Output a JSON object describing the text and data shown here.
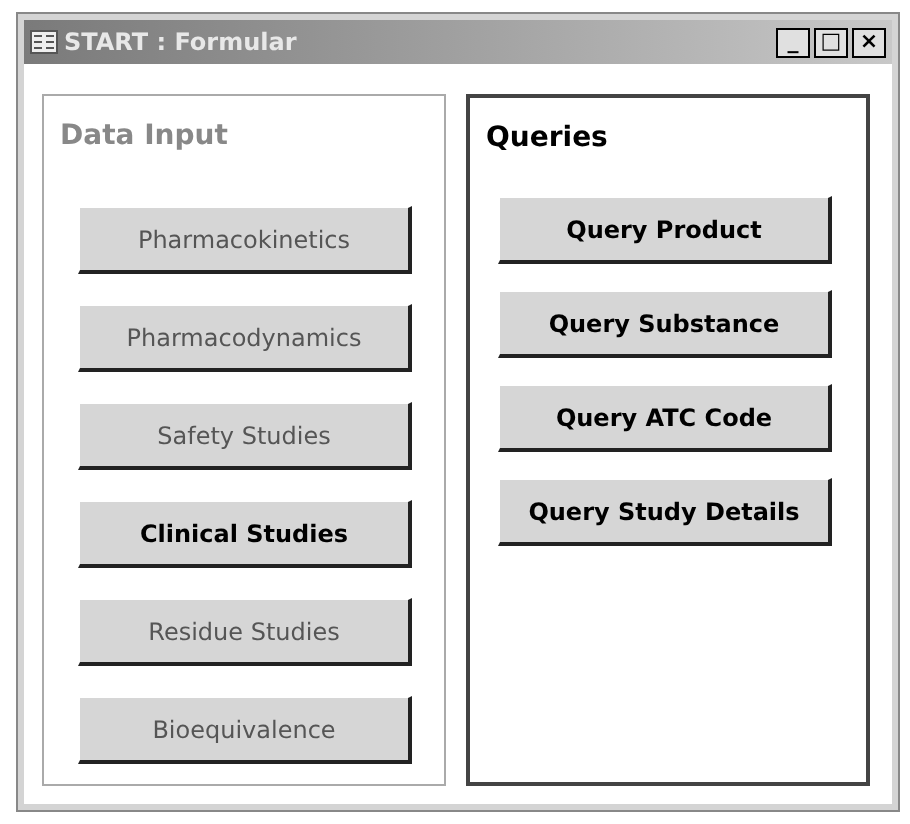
{
  "window": {
    "title": "START : Formular",
    "controls": [
      "_",
      "□",
      "×"
    ]
  },
  "sections": [
    {
      "title": "Data Input",
      "active": false,
      "buttons": [
        {
          "label": "Pharmacokinetics",
          "disabled": true
        },
        {
          "label": "Pharmacodynamics",
          "disabled": true
        },
        {
          "label": "Safety Studies",
          "disabled": true
        },
        {
          "label": "Clinical Studies",
          "disabled": false
        },
        {
          "label": "Residue Studies",
          "disabled": true
        },
        {
          "label": "Bioequivalence",
          "disabled": true
        }
      ]
    },
    {
      "title": "Queries",
      "active": true,
      "buttons": [
        {
          "label": "Query Product",
          "disabled": false
        },
        {
          "label": "Query Substance",
          "disabled": false
        },
        {
          "label": "Query ATC Code",
          "disabled": false
        },
        {
          "label": "Query Study Details",
          "disabled": false
        }
      ]
    }
  ]
}
